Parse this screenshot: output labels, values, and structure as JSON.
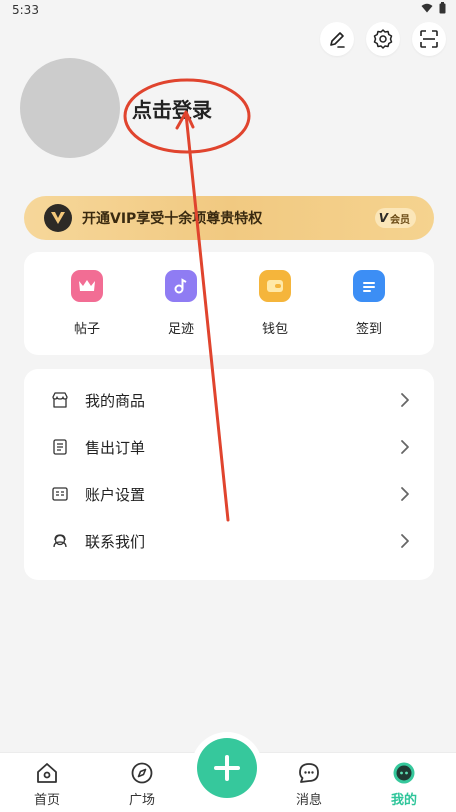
{
  "status_bar": {
    "time": "5:33"
  },
  "profile": {
    "login_text": "点击登录"
  },
  "vip": {
    "text": "开通VIP享受十余项尊贵特权",
    "badge": "会员",
    "badge_mark": "V"
  },
  "quick_actions": [
    {
      "label": "帖子",
      "icon": "crown-icon",
      "color": "#f26d94"
    },
    {
      "label": "足迹",
      "icon": "music-note-icon",
      "color": "#8f7cf3"
    },
    {
      "label": "钱包",
      "icon": "wallet-icon",
      "color": "#f5b53b"
    },
    {
      "label": "签到",
      "icon": "checkin-icon",
      "color": "#3c8ef5"
    }
  ],
  "menu": [
    {
      "label": "我的商品",
      "icon": "store-icon"
    },
    {
      "label": "售出订单",
      "icon": "order-icon"
    },
    {
      "label": "账户设置",
      "icon": "account-icon"
    },
    {
      "label": "联系我们",
      "icon": "support-icon"
    }
  ],
  "tabs": [
    {
      "label": "首页",
      "icon": "home-icon"
    },
    {
      "label": "广场",
      "icon": "compass-icon"
    },
    {
      "label": "消息",
      "icon": "message-icon"
    },
    {
      "label": "我的",
      "icon": "mine-icon",
      "active": true
    }
  ],
  "colors": {
    "accent": "#36c89c",
    "annotation": "#e0442e"
  }
}
